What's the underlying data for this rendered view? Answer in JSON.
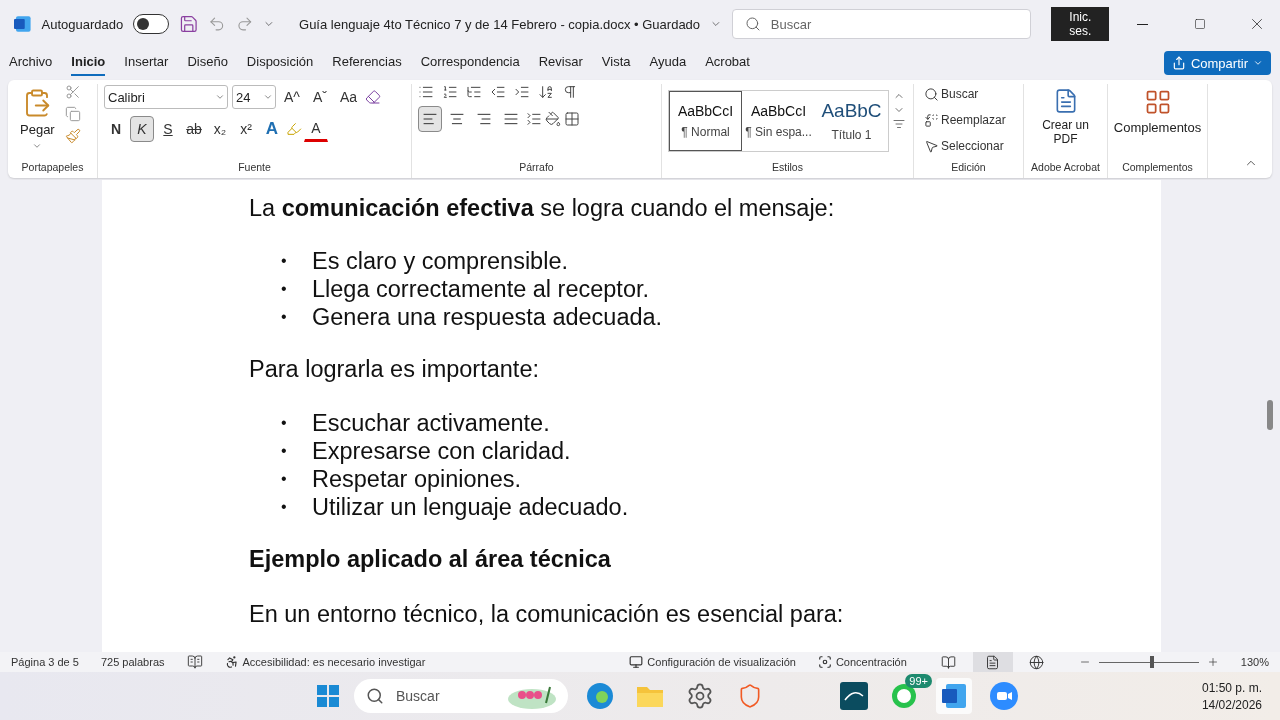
{
  "titlebar": {
    "autosave_label": "Autoguardado",
    "autosave_on": false,
    "title": "Guía lenguaje 4to Técnico 7 y de 14 Febrero - copia.docx • Guardado",
    "search_placeholder": "Buscar",
    "signin": "Inic. ses."
  },
  "menu_tabs": [
    {
      "label": "Archivo",
      "selected": false
    },
    {
      "label": "Inicio",
      "selected": true
    },
    {
      "label": "Insertar",
      "selected": false
    },
    {
      "label": "Diseño",
      "selected": false
    },
    {
      "label": "Disposición",
      "selected": false
    },
    {
      "label": "Referencias",
      "selected": false
    },
    {
      "label": "Correspondencia",
      "selected": false
    },
    {
      "label": "Revisar",
      "selected": false
    },
    {
      "label": "Vista",
      "selected": false
    },
    {
      "label": "Ayuda",
      "selected": false
    },
    {
      "label": "Acrobat",
      "selected": false
    }
  ],
  "share_button": "Compartir",
  "ribbon": {
    "paste": "Pegar",
    "font_name": "Calibri",
    "font_size": "24",
    "grow": "A^",
    "shrink": "Aˇ",
    "case": "Aa",
    "format_buttons": [
      {
        "label": "N",
        "kind": "bold",
        "on": false
      },
      {
        "label": "K",
        "kind": "italic",
        "on": true
      },
      {
        "label": "S",
        "kind": "underline",
        "on": false
      },
      {
        "label": "ab",
        "kind": "strike",
        "on": false
      },
      {
        "label": "x₂",
        "kind": "sub",
        "on": false
      },
      {
        "label": "x²",
        "kind": "sup",
        "on": false
      }
    ],
    "effects": "A",
    "font_color": "A",
    "alignments": [
      {
        "kind": "left",
        "selected": true
      },
      {
        "kind": "center",
        "selected": false
      },
      {
        "kind": "right",
        "selected": false
      },
      {
        "kind": "justify",
        "selected": false
      }
    ],
    "styles": [
      {
        "preview": "AaBbCcI",
        "name": "¶ Normal",
        "kind": "normal",
        "selected": true
      },
      {
        "preview": "AaBbCcI",
        "name": "¶ Sin espa...",
        "kind": "normal",
        "selected": false
      },
      {
        "preview": "AaBbC",
        "name": "Título 1",
        "kind": "heading",
        "selected": false
      }
    ],
    "editing": [
      {
        "label": "Buscar",
        "kind": "search"
      },
      {
        "label": "Reemplazar",
        "kind": "replace"
      },
      {
        "label": "Seleccionar",
        "kind": "select"
      }
    ],
    "acrobat": "Crear un PDF",
    "addins": "Complementos",
    "groups": [
      "Portapapeles",
      "Fuente",
      "Párrafo",
      "Estilos",
      "Edición",
      "Adobe Acrobat",
      "Complementos"
    ]
  },
  "document": [
    {
      "kind": "paragraph",
      "text": "La **comunicación efectiva** se logra cuando el mensaje:"
    },
    {
      "kind": "bullets",
      "items": [
        {
          "marker": "•",
          "text": "Es claro y comprensible."
        },
        {
          "marker": "•",
          "text": "Llega correctamente al receptor."
        },
        {
          "marker": "•",
          "text": "Genera una respuesta adecuada."
        }
      ]
    },
    {
      "kind": "paragraph",
      "text": "Para lograrla es importante:"
    },
    {
      "kind": "bullets",
      "items": [
        {
          "marker": "•",
          "text": "Escuchar activamente."
        },
        {
          "marker": "•",
          "text": "Expresarse con claridad."
        },
        {
          "marker": "•",
          "text": "Respetar opiniones."
        },
        {
          "marker": "•",
          "text": "Utilizar un lenguaje adecuado."
        }
      ]
    },
    {
      "kind": "heading",
      "text": "Ejemplo aplicado al área técnica"
    },
    {
      "kind": "paragraph",
      "text": "En un entorno técnico, la comunicación es esencial para:"
    }
  ],
  "status_bar": {
    "page": "Página 3 de 5",
    "words": "725 palabras",
    "accessibility": "Accesibilidad: es necesario investigar",
    "display": "Configuración de visualización",
    "focus": "Concentración",
    "views": [
      {
        "kind": "read",
        "selected": false
      },
      {
        "kind": "print",
        "selected": true
      },
      {
        "kind": "web",
        "selected": false
      }
    ],
    "zoom": {
      "level": 0.53,
      "reading": "130%"
    }
  },
  "taskbar": {
    "search_placeholder": "Buscar",
    "badge": "99+",
    "time": "01:50 p. m.",
    "date": "14/02/2026"
  }
}
